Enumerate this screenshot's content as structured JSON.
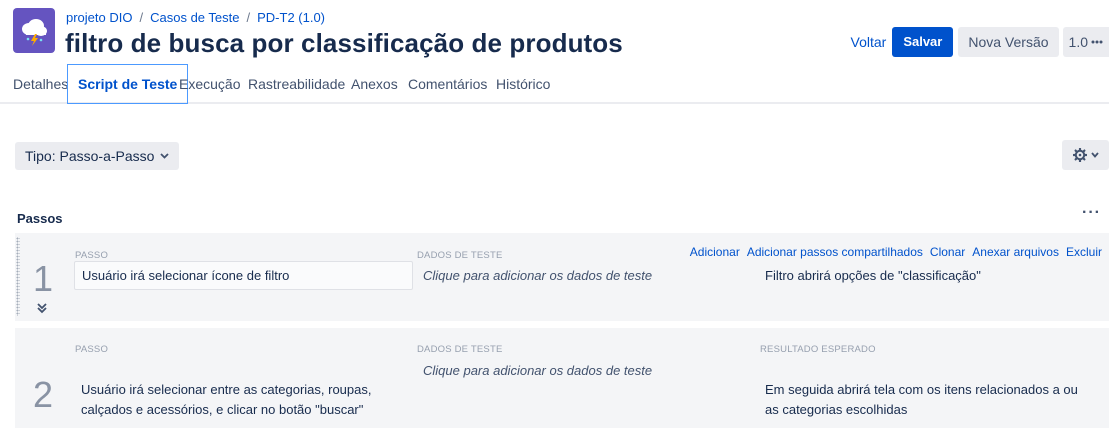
{
  "breadcrumb": {
    "project": "projeto DIO",
    "separator": "/",
    "section": "Casos de Teste",
    "issue": "PD-T2 (1.0)"
  },
  "title": "filtro de busca por classificação de produtos",
  "actions": {
    "back": "Voltar",
    "save": "Salvar",
    "new_version": "Nova Versão",
    "version": "1.0"
  },
  "tabs": [
    {
      "label": "Detalhes"
    },
    {
      "label": "Script de Teste",
      "active": true
    },
    {
      "label": "Execução"
    },
    {
      "label": "Rastreabilidade"
    },
    {
      "label": "Anexos"
    },
    {
      "label": "Comentários"
    },
    {
      "label": "Histórico"
    }
  ],
  "script_type": "Tipo: Passo-a-Passo",
  "section_title": "Passos",
  "columns": {
    "step": "PASSO",
    "test_data": "DADOS DE TESTE",
    "expected": "RESULTADO ESPERADO"
  },
  "step_actions": [
    "Adicionar",
    "Adicionar passos compartilhados",
    "Clonar",
    "Anexar arquivos",
    "Excluir"
  ],
  "steps": [
    {
      "number": "1",
      "step": "Usuário irá selecionar ícone de filtro",
      "test_data": "Clique para adicionar os dados de teste",
      "expected": "Filtro abrirá opções de \"classificação\""
    },
    {
      "number": "2",
      "step": "Usuário irá selecionar entre as categorias, roupas, calçados e acessórios, e clicar no botão \"buscar\"",
      "test_data": "Clique para adicionar os dados de teste",
      "expected": "Em seguida abrirá tela com os itens relacionados a ou as categorias escolhidas"
    }
  ],
  "colors": {
    "primary": "#0052cc",
    "logo_bg": "#6554c0",
    "step_bg": "#f4f5f7",
    "active_tab_border": "#4c9aff"
  },
  "icons": [
    "storm-cloud-icon",
    "more-icon",
    "chevron-down-icon",
    "gear-icon",
    "drag-handle-icon",
    "double-chevron-down-icon"
  ]
}
